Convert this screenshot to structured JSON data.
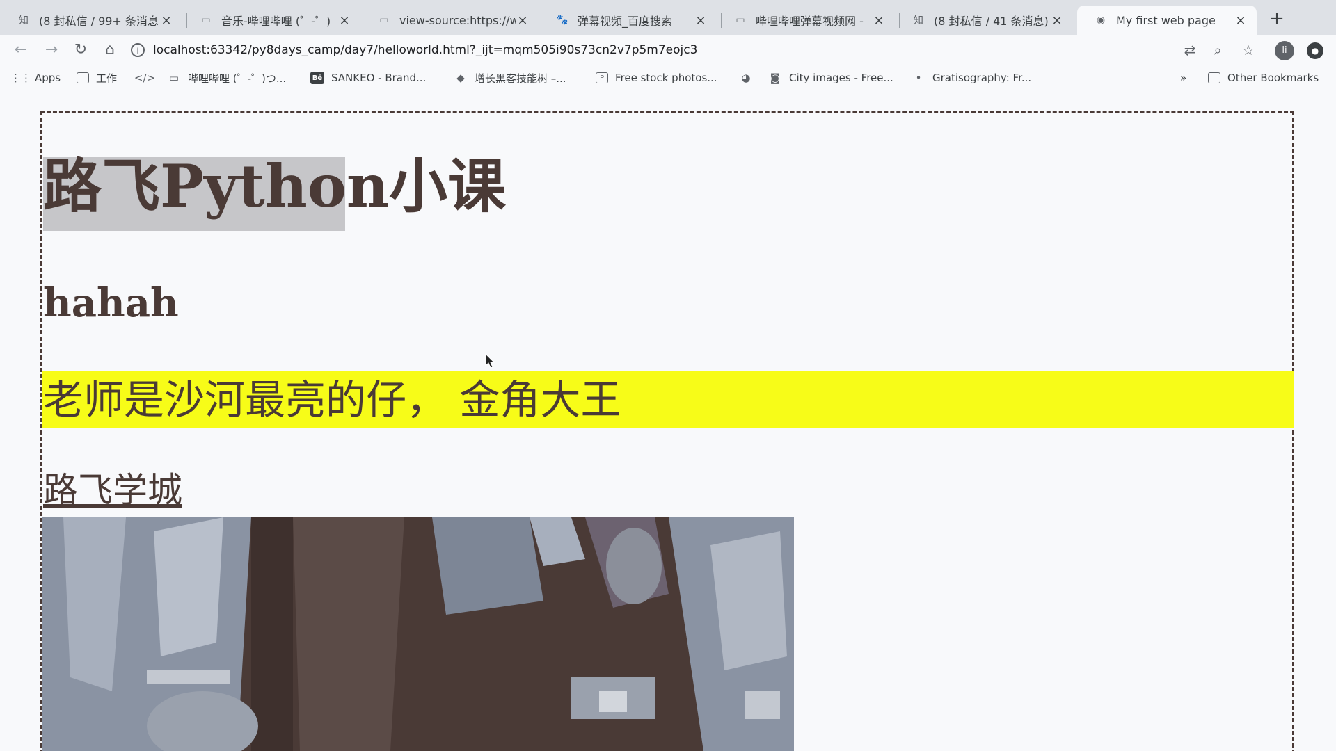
{
  "tabs": [
    {
      "icon": "知",
      "label": "(8 封私信 / 99+ 条消息"
    },
    {
      "icon": "▭",
      "label": "音乐-哔哩哔哩 (゜-゜)"
    },
    {
      "icon": "▭",
      "label": "view-source:https://w"
    },
    {
      "icon": "🐾",
      "label": "弹幕视频_百度搜索"
    },
    {
      "icon": "▭",
      "label": "哔哩哔哩弹幕视频网 -"
    },
    {
      "icon": "知",
      "label": "(8 封私信 / 41 条消息)"
    },
    {
      "icon": "◉",
      "label": "My first web page"
    }
  ],
  "address_bar": {
    "url": "localhost:63342/py8days_camp/day7/helloworld.html?_ijt=mqm505i90s73cn2v7p5m7eojc3"
  },
  "bookmarks": [
    {
      "label": "Apps"
    },
    {
      "label": "工作"
    },
    {
      "label": ""
    },
    {
      "label": "哔哩哔哩 (゜-゜)つ..."
    },
    {
      "label": "SANKEO - Brand..."
    },
    {
      "label": "增长黑客技能树 –..."
    },
    {
      "label": "Free stock photos..."
    },
    {
      "label": ""
    },
    {
      "label": "City images - Free..."
    },
    {
      "label": "Gratisography: Fr..."
    }
  ],
  "other_bookmarks": "Other Bookmarks",
  "overflow_chevron": "»",
  "page": {
    "h1": "路飞Python小课",
    "h2": "hahah",
    "banner_text": "老师是沙河最亮的仔，  金角大王",
    "link_text": "路飞学城"
  },
  "colors": {
    "text": "#4a3a36",
    "banner": "#f7fc18",
    "tabstrip": "#dee1e6",
    "selection": "#c6c6c9"
  }
}
